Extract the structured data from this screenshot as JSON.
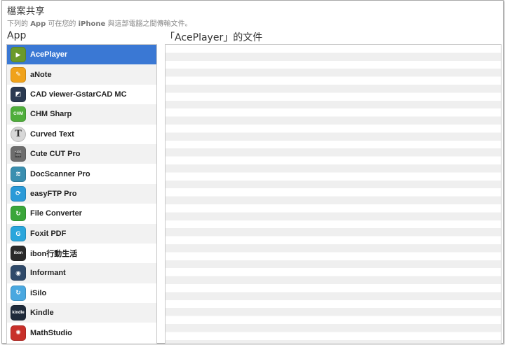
{
  "header": {
    "title": "檔案共享",
    "description_prefix": "下列的 ",
    "description_app": "App",
    "description_mid": " 可在您的 ",
    "description_iphone": "iPhone",
    "description_suffix": " 與這部電腦之間傳輸文件。"
  },
  "columns": {
    "apps_heading": "App",
    "docs_heading": "「AcePlayer」的文件"
  },
  "apps": [
    {
      "label": "AcePlayer",
      "icon": "play-icon",
      "glyph": "▶",
      "color": "#6b9a2a",
      "selected": true
    },
    {
      "label": "aNote",
      "icon": "note-icon",
      "glyph": "✎",
      "color": "#f0a21a",
      "selected": false
    },
    {
      "label": "CAD viewer-GstarCAD MC",
      "icon": "cad-icon",
      "glyph": "◩",
      "color": "#2b3a52",
      "selected": false
    },
    {
      "label": "CHM Sharp",
      "icon": "chm-icon",
      "glyph": "CHM",
      "color": "#4fae3b",
      "selected": false
    },
    {
      "label": "Curved Text",
      "icon": "letter-t-icon",
      "glyph": "T",
      "color": "#d8d8d8",
      "selected": false
    },
    {
      "label": "Cute CUT Pro",
      "icon": "clapperboard-icon",
      "glyph": "🎬",
      "color": "#6d6d6d",
      "selected": false
    },
    {
      "label": "DocScanner Pro",
      "icon": "scanner-icon",
      "glyph": "≋",
      "color": "#3a8fb0",
      "selected": false
    },
    {
      "label": "easyFTP Pro",
      "icon": "ftp-sync-icon",
      "glyph": "⟳",
      "color": "#2a9ad8",
      "selected": false
    },
    {
      "label": "File Converter",
      "icon": "converter-icon",
      "glyph": "↻",
      "color": "#3aa63a",
      "selected": false
    },
    {
      "label": "Foxit PDF",
      "icon": "pdf-icon",
      "glyph": "G",
      "color": "#2aa6dc",
      "selected": false
    },
    {
      "label": "ibon行動生活",
      "icon": "ibon-icon",
      "glyph": "ibon",
      "color": "#2b2b2b",
      "selected": false
    },
    {
      "label": "Informant",
      "icon": "informant-icon",
      "glyph": "◉",
      "color": "#2f4a6a",
      "selected": false
    },
    {
      "label": "iSilo",
      "icon": "isilo-icon",
      "glyph": "↻",
      "color": "#4aa8e0",
      "selected": false
    },
    {
      "label": "Kindle",
      "icon": "kindle-icon",
      "glyph": "kindle",
      "color": "#1f2a3a",
      "selected": false
    },
    {
      "label": "MathStudio",
      "icon": "mathstudio-icon",
      "glyph": "✺",
      "color": "#c8302a",
      "selected": false
    }
  ]
}
